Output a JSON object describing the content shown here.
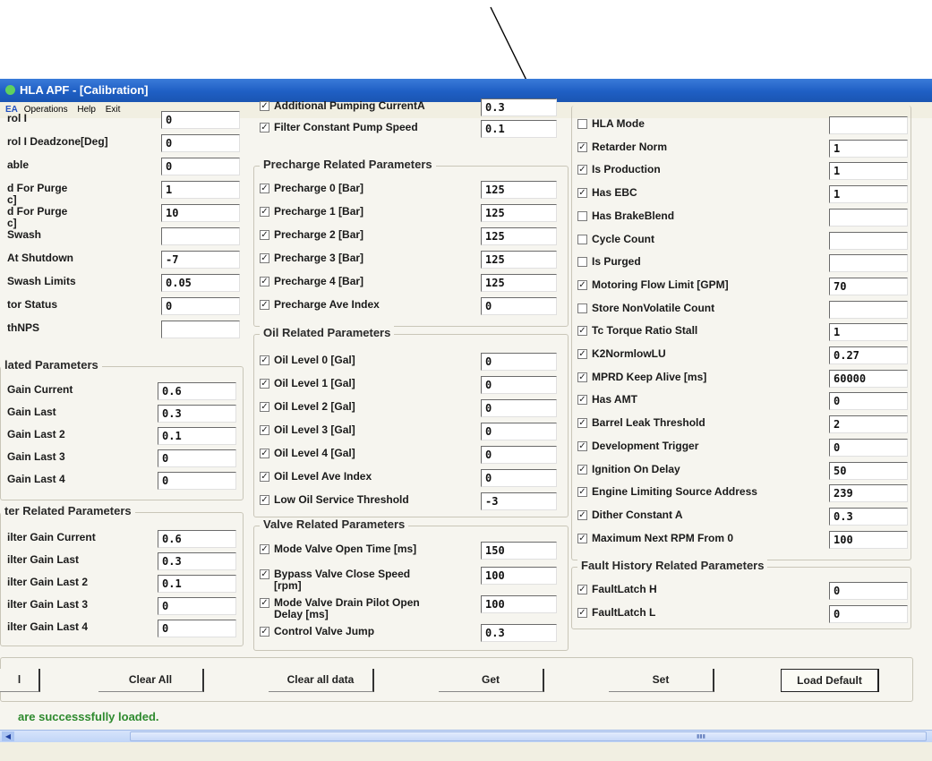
{
  "window": {
    "title": "HLA APF - [Calibration]"
  },
  "menu": {
    "icon_label": "EA",
    "items": [
      "Operations",
      "Help",
      "Exit"
    ]
  },
  "col1": {
    "rows": [
      {
        "label": "rol I",
        "value": "0"
      },
      {
        "label": "rol I Deadzone[Deg]",
        "value": "0"
      },
      {
        "label": "able",
        "value": "0"
      },
      {
        "label": "d For Purge\nc]",
        "value": "1"
      },
      {
        "label": "d For Purge\nc]",
        "value": "10"
      },
      {
        "label": "Swash",
        "value": ""
      },
      {
        "label": "At Shutdown",
        "value": "-7"
      },
      {
        "label": "Swash Limits",
        "value": "0.05"
      },
      {
        "label": "tor Status",
        "value": "0"
      },
      {
        "label": "thNPS",
        "value": ""
      }
    ],
    "group2": {
      "title": "lated Parameters",
      "rows": [
        {
          "label": "Gain Current",
          "value": "0.6"
        },
        {
          "label": "Gain Last",
          "value": "0.3"
        },
        {
          "label": "Gain Last 2",
          "value": "0.1"
        },
        {
          "label": "Gain Last 3",
          "value": "0"
        },
        {
          "label": "Gain Last 4",
          "value": "0"
        }
      ]
    },
    "group3": {
      "title": "ter Related Parameters",
      "rows": [
        {
          "label": "ilter Gain Current",
          "value": "0.6"
        },
        {
          "label": "ilter Gain Last",
          "value": "0.3"
        },
        {
          "label": "ilter Gain Last 2",
          "value": "0.1"
        },
        {
          "label": "ilter Gain Last 3",
          "value": "0"
        },
        {
          "label": "ilter Gain Last 4",
          "value": "0"
        }
      ]
    }
  },
  "col2": {
    "top_rows": [
      {
        "label": "Additional Pumping CurrentA",
        "value": "0.3"
      },
      {
        "label": "Filter Constant Pump Speed",
        "value": "0.1"
      }
    ],
    "precharge": {
      "title": "Precharge Related Parameters",
      "rows": [
        {
          "label": "Precharge 0 [Bar]",
          "value": "125"
        },
        {
          "label": "Precharge 1 [Bar]",
          "value": "125"
        },
        {
          "label": "Precharge 2 [Bar]",
          "value": "125"
        },
        {
          "label": "Precharge 3 [Bar]",
          "value": "125"
        },
        {
          "label": "Precharge 4 [Bar]",
          "value": "125"
        },
        {
          "label": "Precharge Ave Index",
          "value": "0"
        }
      ]
    },
    "oil": {
      "title": "Oil Related Parameters",
      "rows": [
        {
          "label": "Oil Level 0 [Gal]",
          "value": "0"
        },
        {
          "label": "Oil Level 1 [Gal]",
          "value": "0"
        },
        {
          "label": "Oil Level 2 [Gal]",
          "value": "0"
        },
        {
          "label": "Oil Level 3 [Gal]",
          "value": "0"
        },
        {
          "label": "Oil Level 4 [Gal]",
          "value": "0"
        },
        {
          "label": "Oil Level Ave Index",
          "value": "0"
        },
        {
          "label": "Low Oil Service Threshold",
          "value": "-3"
        }
      ]
    },
    "valve": {
      "title": "Valve Related Parameters",
      "rows": [
        {
          "label": "Mode Valve Open Time [ms]",
          "value": "150"
        },
        {
          "label": "Bypass Valve Close Speed\n[rpm]",
          "value": "100"
        },
        {
          "label": "Mode Valve Drain Pilot Open\nDelay [ms]",
          "value": "100"
        },
        {
          "label": "Control Valve Jump",
          "value": "0.3"
        }
      ]
    }
  },
  "col3": {
    "other": {
      "rows": [
        {
          "label": "HLA Mode",
          "checked": false,
          "value": ""
        },
        {
          "label": "Retarder Norm",
          "checked": true,
          "value": "1"
        },
        {
          "label": "Is Production",
          "checked": true,
          "value": "1"
        },
        {
          "label": "Has EBC",
          "checked": true,
          "value": "1"
        },
        {
          "label": "Has BrakeBlend",
          "checked": false,
          "value": ""
        },
        {
          "label": "Cycle Count",
          "checked": false,
          "value": ""
        },
        {
          "label": "Is Purged",
          "checked": false,
          "value": ""
        },
        {
          "label": "Motoring Flow Limit [GPM]",
          "checked": true,
          "value": "70"
        },
        {
          "label": "Store NonVolatile Count",
          "checked": false,
          "value": ""
        },
        {
          "label": "Tc Torque Ratio Stall",
          "checked": true,
          "value": "1"
        },
        {
          "label": "K2NormlowLU",
          "checked": true,
          "value": "0.27"
        },
        {
          "label": "MPRD Keep Alive [ms]",
          "checked": true,
          "value": "60000"
        },
        {
          "label": "Has AMT",
          "checked": true,
          "value": "0"
        },
        {
          "label": "Barrel Leak Threshold",
          "checked": true,
          "value": "2"
        },
        {
          "label": "Development Trigger",
          "checked": true,
          "value": "0"
        },
        {
          "label": "Ignition On Delay",
          "checked": true,
          "value": "50"
        },
        {
          "label": "Engine Limiting Source Address",
          "checked": true,
          "value": "239"
        },
        {
          "label": "Dither Constant A",
          "checked": true,
          "value": "0.3"
        },
        {
          "label": "Maximum Next RPM From 0",
          "checked": true,
          "value": "100"
        }
      ]
    },
    "fault": {
      "title": "Fault History Related Parameters",
      "rows": [
        {
          "label": "FaultLatch H",
          "checked": true,
          "value": "0"
        },
        {
          "label": "FaultLatch L",
          "checked": true,
          "value": "0"
        }
      ]
    }
  },
  "buttons": {
    "partial": "l",
    "clear_all": "Clear All",
    "clear_all_data": "Clear all data",
    "get": "Get",
    "set": "Set",
    "load_default": "Load Default"
  },
  "status": "are successsfully loaded.",
  "check_glyph": "☑"
}
